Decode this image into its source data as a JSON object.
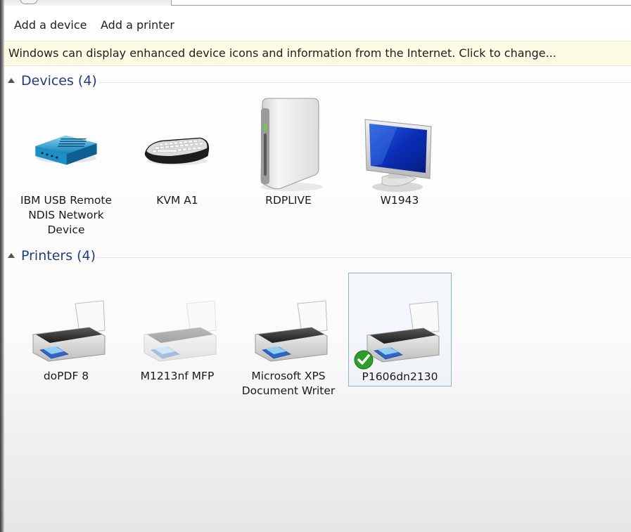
{
  "toolbar": {
    "add_device": "Add a device",
    "add_printer": "Add a printer"
  },
  "infobar": {
    "text": "Windows can display enhanced device icons and information from the Internet. Click to change..."
  },
  "devices": {
    "header": "Devices (4)",
    "items": [
      {
        "label_lines": [
          "IBM USB Remote",
          "NDIS Network",
          "Device"
        ],
        "icon": "network-adapter-icon"
      },
      {
        "label_lines": [
          "KVM A1"
        ],
        "icon": "keyboard-icon"
      },
      {
        "label_lines": [
          "RDPLIVE"
        ],
        "icon": "computer-tower-icon"
      },
      {
        "label_lines": [
          "W1943"
        ],
        "icon": "monitor-icon"
      }
    ]
  },
  "printers": {
    "header": "Printers (4)",
    "items": [
      {
        "label_lines": [
          "doPDF 8"
        ],
        "icon": "printer-icon"
      },
      {
        "label_lines": [
          "M1213nf MFP"
        ],
        "icon": "printer-icon",
        "state": "offline"
      },
      {
        "label_lines": [
          "Microsoft XPS",
          "Document Writer"
        ],
        "icon": "printer-icon"
      },
      {
        "label_lines": [
          "P1606dn2130"
        ],
        "icon": "printer-icon",
        "default": true,
        "selected": true
      }
    ]
  },
  "colors": {
    "group_title": "#1f3d8a",
    "infobar_bg": "#fcfbe3",
    "selection_border": "#8fb3d6",
    "default_check": "#2e9e2a"
  }
}
